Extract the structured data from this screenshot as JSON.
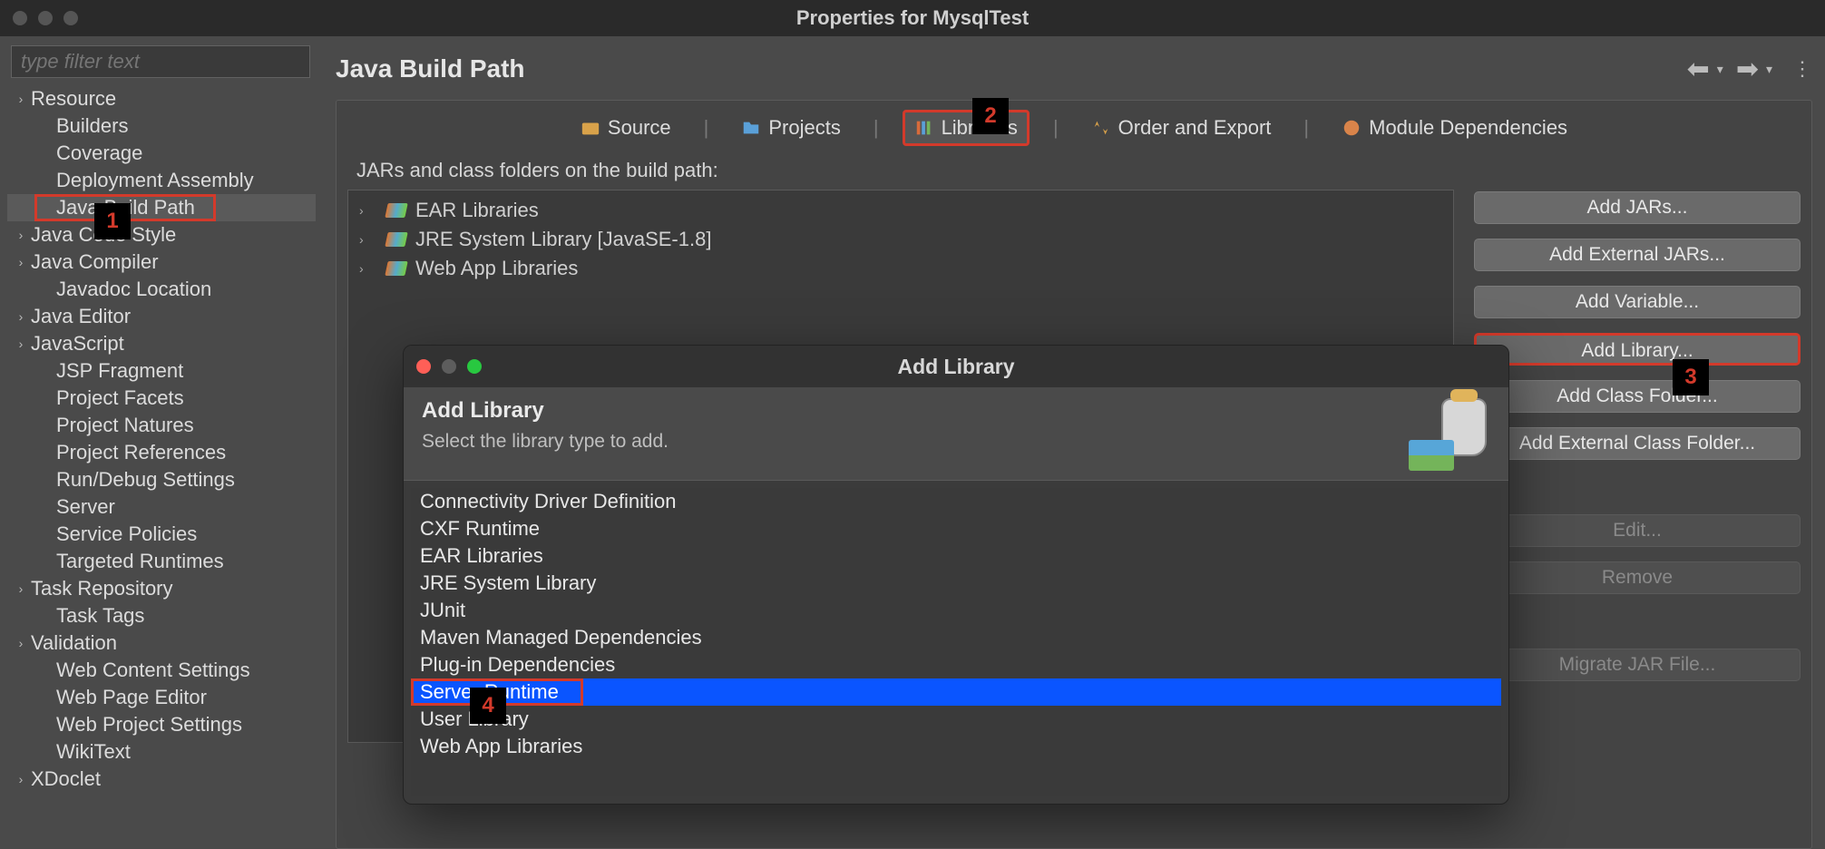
{
  "window": {
    "title": "Properties for MysqlTest"
  },
  "filter": {
    "placeholder": "type filter text"
  },
  "nav_items": [
    {
      "label": "Resource",
      "expandable": true
    },
    {
      "label": "Builders",
      "expandable": false,
      "indent": true
    },
    {
      "label": "Coverage",
      "expandable": false,
      "indent": true
    },
    {
      "label": "Deployment Assembly",
      "expandable": false,
      "indent": true
    },
    {
      "label": "Java Build Path",
      "expandable": false,
      "indent": true,
      "selected": true
    },
    {
      "label": "Java Code Style",
      "expandable": true
    },
    {
      "label": "Java Compiler",
      "expandable": true
    },
    {
      "label": "Javadoc Location",
      "expandable": false,
      "indent": true
    },
    {
      "label": "Java Editor",
      "expandable": true
    },
    {
      "label": "JavaScript",
      "expandable": true
    },
    {
      "label": "JSP Fragment",
      "expandable": false,
      "indent": true
    },
    {
      "label": "Project Facets",
      "expandable": false,
      "indent": true
    },
    {
      "label": "Project Natures",
      "expandable": false,
      "indent": true
    },
    {
      "label": "Project References",
      "expandable": false,
      "indent": true
    },
    {
      "label": "Run/Debug Settings",
      "expandable": false,
      "indent": true
    },
    {
      "label": "Server",
      "expandable": false,
      "indent": true
    },
    {
      "label": "Service Policies",
      "expandable": false,
      "indent": true
    },
    {
      "label": "Targeted Runtimes",
      "expandable": false,
      "indent": true
    },
    {
      "label": "Task Repository",
      "expandable": true
    },
    {
      "label": "Task Tags",
      "expandable": false,
      "indent": true
    },
    {
      "label": "Validation",
      "expandable": true
    },
    {
      "label": "Web Content Settings",
      "expandable": false,
      "indent": true
    },
    {
      "label": "Web Page Editor",
      "expandable": false,
      "indent": true
    },
    {
      "label": "Web Project Settings",
      "expandable": false,
      "indent": true
    },
    {
      "label": "WikiText",
      "expandable": false,
      "indent": true
    },
    {
      "label": "XDoclet",
      "expandable": true
    }
  ],
  "page": {
    "title": "Java Build Path"
  },
  "tabs": [
    {
      "label": "Source"
    },
    {
      "label": "Projects"
    },
    {
      "label": "Libraries",
      "active": true
    },
    {
      "label": "Order and Export"
    },
    {
      "label": "Module Dependencies"
    }
  ],
  "lib_caption": "JARs and class folders on the build path:",
  "lib_entries": [
    {
      "label": "EAR Libraries"
    },
    {
      "label": "JRE System Library [JavaSE-1.8]"
    },
    {
      "label": "Web App Libraries"
    }
  ],
  "buttons": [
    {
      "label": "Add JARs...",
      "enabled": true
    },
    {
      "label": "Add External JARs...",
      "enabled": true
    },
    {
      "label": "Add Variable...",
      "enabled": true
    },
    {
      "label": "Add Library...",
      "enabled": true,
      "highlight": true
    },
    {
      "label": "Add Class Folder...",
      "enabled": true
    },
    {
      "label": "Add External Class Folder...",
      "enabled": true
    },
    {
      "gap": true
    },
    {
      "label": "Edit...",
      "enabled": false
    },
    {
      "label": "Remove",
      "enabled": false
    },
    {
      "gap": true
    },
    {
      "label": "Migrate JAR File...",
      "enabled": false
    }
  ],
  "modal": {
    "title": "Add Library",
    "heading": "Add Library",
    "subtext": "Select the library type to add.",
    "items": [
      {
        "label": "Connectivity Driver Definition"
      },
      {
        "label": "CXF Runtime"
      },
      {
        "label": "EAR Libraries"
      },
      {
        "label": "JRE System Library"
      },
      {
        "label": "JUnit"
      },
      {
        "label": "Maven Managed Dependencies"
      },
      {
        "label": "Plug-in Dependencies"
      },
      {
        "label": "Server Runtime",
        "selected": true
      },
      {
        "label": "User Library"
      },
      {
        "label": "Web App Libraries"
      }
    ]
  },
  "callouts": {
    "c1": "1",
    "c2": "2",
    "c3": "3",
    "c4": "4"
  }
}
